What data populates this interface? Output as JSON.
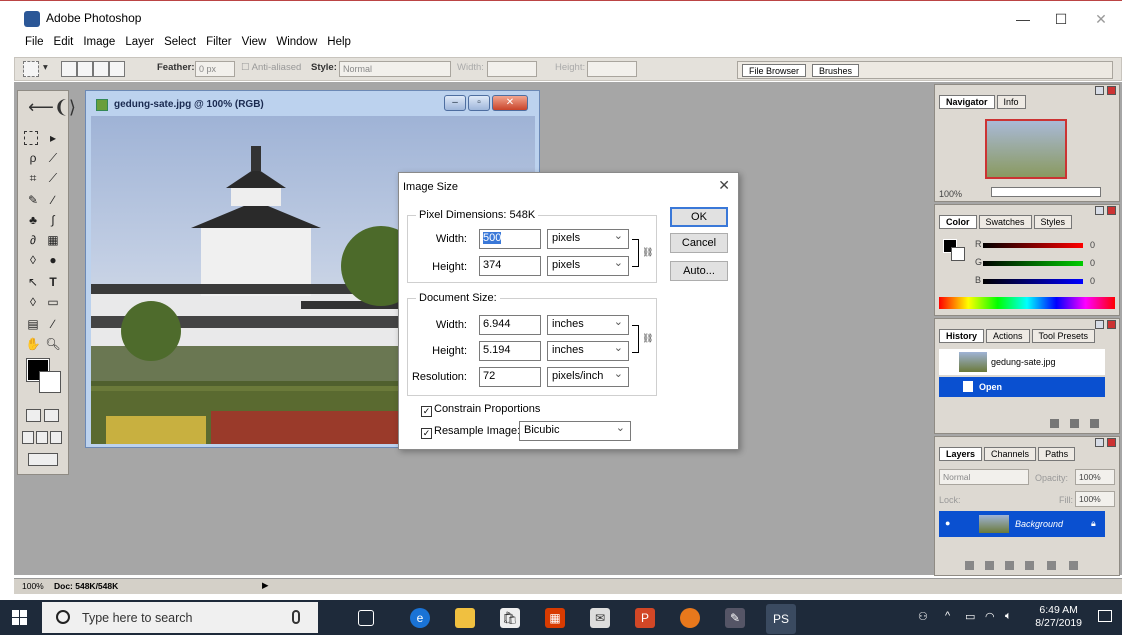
{
  "app": {
    "title": "Adobe Photoshop"
  },
  "window_controls": {
    "minimize": "—",
    "maximize": "☐",
    "close": "✕"
  },
  "menu": [
    "File",
    "Edit",
    "Image",
    "Layer",
    "Select",
    "Filter",
    "View",
    "Window",
    "Help"
  ],
  "options_bar": {
    "feather_label": "Feather:",
    "feather_value": "0 px",
    "anti_aliased": "Anti-aliased",
    "style_label": "Style:",
    "style_value": "Normal",
    "width_label": "Width:",
    "height_label": "Height:",
    "palette_tabs": [
      "File Browser",
      "Brushes"
    ]
  },
  "document": {
    "title": "gedung-sate.jpg @ 100% (RGB)"
  },
  "dialog": {
    "title": "Image Size",
    "pixel_group": "Pixel Dimensions:  548K",
    "px_width_label": "Width:",
    "px_width_value": "500",
    "px_width_unit": "pixels",
    "px_height_label": "Height:",
    "px_height_value": "374",
    "px_height_unit": "pixels",
    "doc_group": "Document Size:",
    "doc_width_label": "Width:",
    "doc_width_value": "6.944",
    "doc_width_unit": "inches",
    "doc_height_label": "Height:",
    "doc_height_value": "5.194",
    "doc_height_unit": "inches",
    "res_label": "Resolution:",
    "res_value": "72",
    "res_unit": "pixels/inch",
    "constrain": "Constrain Proportions",
    "resample": "Resample Image:",
    "resample_value": "Bicubic",
    "ok": "OK",
    "cancel": "Cancel",
    "auto": "Auto..."
  },
  "navigator": {
    "tabs": [
      "Navigator",
      "Info"
    ],
    "zoom": "100%"
  },
  "color": {
    "tabs": [
      "Color",
      "Swatches",
      "Styles"
    ],
    "r_label": "R",
    "r_value": "0",
    "g_label": "G",
    "g_value": "0",
    "b_label": "B",
    "b_value": "0"
  },
  "history": {
    "tabs": [
      "History",
      "Actions",
      "Tool Presets"
    ],
    "snapshot": "gedung-sate.jpg",
    "state": "Open"
  },
  "layers": {
    "tabs": [
      "Layers",
      "Channels",
      "Paths"
    ],
    "blend": "Normal",
    "opacity_label": "Opacity:",
    "opacity": "100%",
    "lock_label": "Lock:",
    "fill_label": "Fill:",
    "fill": "100%",
    "layer_name": "Background"
  },
  "status": {
    "zoom": "100%",
    "doc": "Doc: 548K/548K"
  },
  "taskbar": {
    "search_placeholder": "Type here to search",
    "time": "6:49 AM",
    "date": "8/27/2019"
  }
}
